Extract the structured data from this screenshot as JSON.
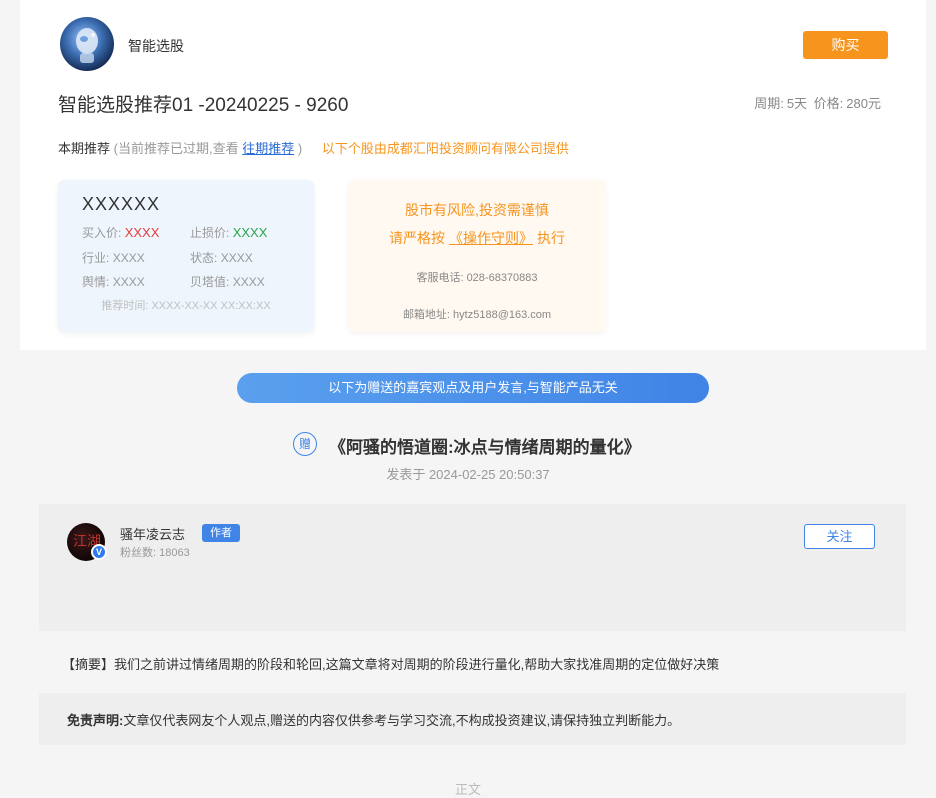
{
  "product": {
    "name": "智能选股",
    "buy_label": "购买"
  },
  "recommendation": {
    "title": "智能选股推荐01 -20240225 - 9260",
    "period_label": "周期:",
    "period_value": "5天",
    "price_label": "价格:",
    "price_value": "280元",
    "current_label": "本期推荐",
    "expired_prefix": "(当前推荐已过期,查看",
    "past_link": "往期推荐",
    "expired_suffix": ")",
    "provider_note": "以下个股由成都汇阳投资顾问有限公司提供"
  },
  "stock_card": {
    "code": "XXXXXX",
    "buy_price_label": "买入价:",
    "buy_price_value": "XXXX",
    "stop_loss_label": "止损价:",
    "stop_loss_value": "XXXX",
    "industry_label": "行业:",
    "industry_value": "XXXX",
    "status_label": "状态:",
    "status_value": "XXXX",
    "sentiment_label": "舆情:",
    "sentiment_value": "XXXX",
    "beta_label": "贝塔值:",
    "beta_value": "XXXX",
    "rec_time_label": "推荐时间:",
    "rec_time_value": "XXXX-XX-XX XX:XX:XX",
    "colors": {
      "buy": "#e23c3c",
      "stop": "#2aa64a"
    }
  },
  "risk_card": {
    "line1": "股市有风险,投资需谨慎",
    "line2_prefix": "请严格按",
    "rules_link": "《操作守则》",
    "line2_suffix": "执行",
    "phone": "客服电话: 028-68370883",
    "email": "邮箱地址: hytz5188@163.com"
  },
  "gift_banner": "以下为赠送的嘉宾观点及用户发言,与智能产品无关",
  "article": {
    "badge": "赠",
    "title": "《阿骚的悟道圈:冰点与情绪周期的量化》",
    "publish_time": "发表于 2024-02-25 20:50:37"
  },
  "author": {
    "avatar_glyph": "江湖",
    "verified_icon": "V",
    "name": "骚年凌云志",
    "tag": "作者",
    "fans": "粉丝数: 18063",
    "follow_label": "关注"
  },
  "summary": "【摘要】我们之前讲过情绪周期的阶段和轮回,这篇文章将对周期的阶段进行量化,帮助大家找准周期的定位做好决策",
  "disclaimer": {
    "label": "免责声明:",
    "text": "文章仅代表网友个人观点,赠送的内容仅供参考与学习交流,不构成投资建议,请保持独立判断能力。"
  },
  "body_start": "正文",
  "theme": {
    "accent": "#3f84e6",
    "orange": "#f7941d"
  }
}
